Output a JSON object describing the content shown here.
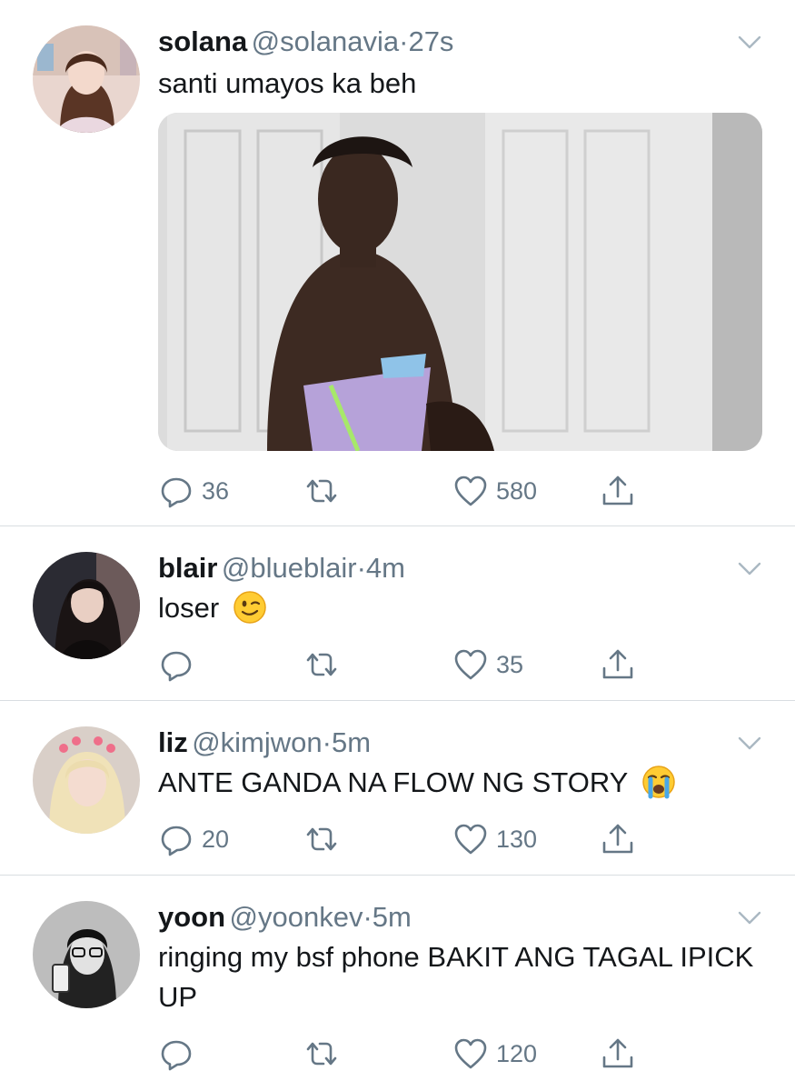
{
  "tweets": [
    {
      "name": "solana",
      "handle": "@solanavia",
      "separator": "·",
      "time": "27s",
      "text": "santi umayos ka beh",
      "replies": "36",
      "retweets": "",
      "likes": "580"
    },
    {
      "name": "blair",
      "handle": "@blueblair",
      "separator": "·",
      "time": "4m",
      "text": "loser",
      "emoji": "winking-face",
      "replies": "",
      "retweets": "",
      "likes": "35"
    },
    {
      "name": "liz",
      "handle": "@kimjwon",
      "separator": "·",
      "time": "5m",
      "text": "ANTE GANDA NA FLOW NG STORY",
      "emoji": "loudly-crying-face",
      "replies": "20",
      "retweets": "",
      "likes": "130"
    },
    {
      "name": "yoon",
      "handle": "@yoonkev",
      "separator": "·",
      "time": "5m",
      "text": "ringing my bsf phone BAKIT ANG TAGAL IPICK UP",
      "replies": "",
      "retweets": "",
      "likes": "120"
    }
  ],
  "colors": {
    "text": "#14171a",
    "muted": "#657786",
    "divider": "#d9dde1"
  }
}
